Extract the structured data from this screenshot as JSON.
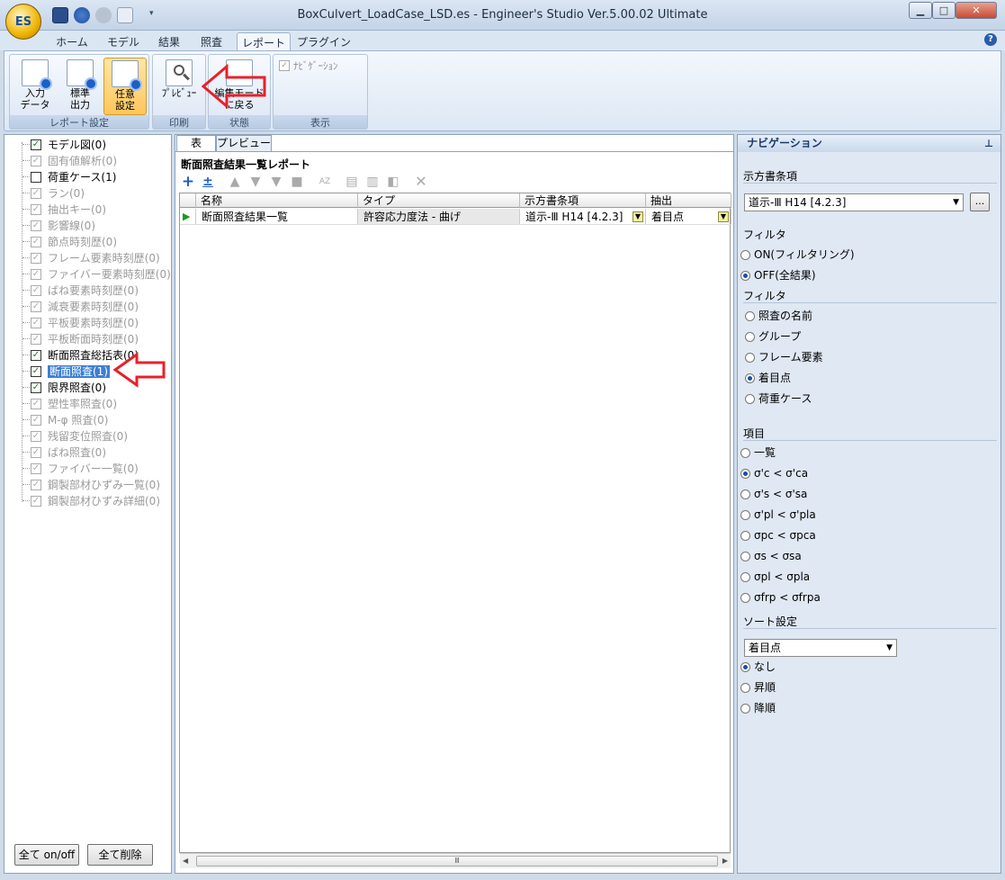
{
  "window": {
    "title": "BoxCulvert_LoadCase_LSD.es - Engineer's Studio Ver.5.00.02 Ultimate",
    "app_logo": "ES"
  },
  "menu_tabs": [
    "ホーム",
    "モデル",
    "結果",
    "照査",
    "レポート",
    "プラグイン"
  ],
  "ribbon": {
    "groups": [
      {
        "label": "レポート設定",
        "buttons": [
          {
            "label": "入力\nデータ",
            "icon": "input-data-icon"
          },
          {
            "label": "標準\n出力",
            "icon": "standard-output-icon"
          },
          {
            "label": "任意\n設定",
            "icon": "custom-settings-icon"
          }
        ]
      },
      {
        "label": "印刷",
        "buttons": [
          {
            "label": "ﾌﾟﾚﾋﾞｭｰ",
            "icon": "preview-icon"
          }
        ]
      },
      {
        "label": "状態",
        "buttons": [
          {
            "label": "編集モード\nに戻る",
            "icon": "edit-mode-icon"
          }
        ]
      },
      {
        "label": "表示",
        "checkbox": {
          "label": "ﾅﾋﾞｹﾞｰｼｮﾝ",
          "checked": true
        }
      }
    ]
  },
  "left_tree": [
    {
      "label": "モデル図(0)",
      "checked": true,
      "enabled": true
    },
    {
      "label": "固有値解析(0)",
      "checked": true,
      "enabled": false
    },
    {
      "label": "荷重ケース(1)",
      "checked": false,
      "enabled": true
    },
    {
      "label": "ラン(0)",
      "checked": true,
      "enabled": false
    },
    {
      "label": "抽出キー(0)",
      "checked": true,
      "enabled": false
    },
    {
      "label": "影響線(0)",
      "checked": true,
      "enabled": false
    },
    {
      "label": "節点時刻歴(0)",
      "checked": true,
      "enabled": false
    },
    {
      "label": "フレーム要素時刻歴(0)",
      "checked": true,
      "enabled": false
    },
    {
      "label": "ファイバー要素時刻歴(0)",
      "checked": true,
      "enabled": false
    },
    {
      "label": "ばね要素時刻歴(0)",
      "checked": true,
      "enabled": false
    },
    {
      "label": "減衰要素時刻歴(0)",
      "checked": true,
      "enabled": false
    },
    {
      "label": "平板要素時刻歴(0)",
      "checked": true,
      "enabled": false
    },
    {
      "label": "平板断面時刻歴(0)",
      "checked": true,
      "enabled": false
    },
    {
      "label": "断面照査総括表(0)",
      "checked": true,
      "enabled": true
    },
    {
      "label": "断面照査(1)",
      "checked": true,
      "enabled": true,
      "selected": true
    },
    {
      "label": "限界照査(0)",
      "checked": true,
      "enabled": true
    },
    {
      "label": "塑性率照査(0)",
      "checked": true,
      "enabled": false
    },
    {
      "label": "M-φ 照査(0)",
      "checked": true,
      "enabled": false
    },
    {
      "label": "残留変位照査(0)",
      "checked": true,
      "enabled": false
    },
    {
      "label": "ばね照査(0)",
      "checked": true,
      "enabled": false
    },
    {
      "label": "ファイバー一覧(0)",
      "checked": true,
      "enabled": false
    },
    {
      "label": "鋼製部材ひずみ一覧(0)",
      "checked": true,
      "enabled": false
    },
    {
      "label": "鋼製部材ひずみ詳細(0)",
      "checked": true,
      "enabled": false
    }
  ],
  "left_buttons": {
    "all_toggle": "全て on/off",
    "delete_all": "全て削除"
  },
  "center": {
    "tabs": [
      "表",
      "プレビュー"
    ],
    "report_title": "断面照査結果一覧レポート",
    "columns": [
      "名称",
      "タイプ",
      "示方書条項",
      "抽出"
    ],
    "rows": [
      [
        "断面照査結果一覧",
        "許容応力度法 - 曲げ",
        "道示-Ⅲ H14 [4.2.3]",
        "着目点"
      ]
    ],
    "hscroll_grip": "Ⅲ"
  },
  "navigation": {
    "title": "ナビゲーション",
    "pin_icon": "pin-icon",
    "clause_label": "示方書条項",
    "clause_value": "道示-Ⅲ H14 [4.2.3]",
    "ellipsis": "...",
    "filter1_label": "フィルタ",
    "filter1_options": [
      {
        "label": "ON(フィルタリング)",
        "on": false
      },
      {
        "label": "OFF(全結果)",
        "on": true
      }
    ],
    "filter2_label": "フィルタ",
    "filter2_options": [
      {
        "label": "照査の名前",
        "on": false
      },
      {
        "label": "グループ",
        "on": false
      },
      {
        "label": "フレーム要素",
        "on": false
      },
      {
        "label": "着目点",
        "on": true
      },
      {
        "label": "荷重ケース",
        "on": false
      }
    ],
    "item_label": "項目",
    "item_options": [
      {
        "label": "一覧",
        "on": false
      },
      {
        "label": "σ'c < σ'ca",
        "on": true
      },
      {
        "label": "σ's < σ'sa",
        "on": false
      },
      {
        "label": "σ'pl < σ'pla",
        "on": false
      },
      {
        "label": "σpc < σpca",
        "on": false
      },
      {
        "label": "σs < σsa",
        "on": false
      },
      {
        "label": "σpl < σpla",
        "on": false
      },
      {
        "label": "σfrp < σfrpa",
        "on": false
      }
    ],
    "sort_label": "ソート設定",
    "sort_value": "着目点",
    "sort_options": [
      {
        "label": "なし",
        "on": true
      },
      {
        "label": "昇順",
        "on": false
      },
      {
        "label": "降順",
        "on": false
      }
    ]
  },
  "colors": {
    "accent": "#3c7fd4",
    "annotation_arrow": "#e8202a",
    "ribbon_active": "#ffc65a"
  }
}
